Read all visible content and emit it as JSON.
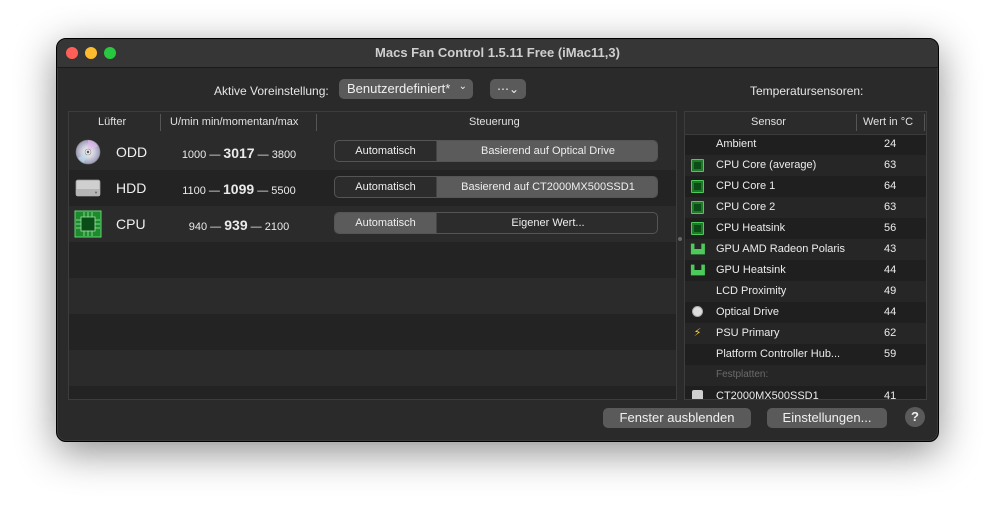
{
  "window": {
    "title": "Macs Fan Control 1.5.11 Free (iMac11,3)"
  },
  "preset": {
    "label": "Aktive Voreinstellung:",
    "value": "Benutzerdefiniert*"
  },
  "temperature_title": "Temperatursensoren:",
  "fans": {
    "columns": {
      "fan": "Lüfter",
      "rpm": "U/min min/momentan/max",
      "control": "Steuerung"
    },
    "rows": [
      {
        "name": "ODD",
        "min": "1000",
        "current": "3017",
        "max": "3800",
        "auto_label": "Automatisch",
        "control_label": "Basierend auf Optical Drive",
        "mode": "sensor",
        "icon": "optical-disc-icon"
      },
      {
        "name": "HDD",
        "min": "1100",
        "current": "1099",
        "max": "5500",
        "auto_label": "Automatisch",
        "control_label": "Basierend auf CT2000MX500SSD1",
        "mode": "sensor",
        "icon": "hard-drive-icon"
      },
      {
        "name": "CPU",
        "min": "940",
        "current": "939",
        "max": "2100",
        "auto_label": "Automatisch",
        "control_label": "Eigener Wert...",
        "mode": "auto",
        "icon": "cpu-chip-icon"
      }
    ]
  },
  "sensors": {
    "columns": {
      "sensor": "Sensor",
      "value": "Wert in °C"
    },
    "rows": [
      {
        "name": "Ambient",
        "value": "24",
        "icon": ""
      },
      {
        "name": "CPU Core (average)",
        "value": "63",
        "icon": "cpu-chip-icon"
      },
      {
        "name": "CPU Core 1",
        "value": "64",
        "icon": "cpu-chip-icon"
      },
      {
        "name": "CPU Core 2",
        "value": "63",
        "icon": "cpu-chip-icon"
      },
      {
        "name": "CPU Heatsink",
        "value": "56",
        "icon": "cpu-chip-icon"
      },
      {
        "name": "GPU AMD Radeon Polaris",
        "value": "43",
        "icon": "gpu-card-icon"
      },
      {
        "name": "GPU Heatsink",
        "value": "44",
        "icon": "gpu-card-icon"
      },
      {
        "name": "LCD Proximity",
        "value": "49",
        "icon": ""
      },
      {
        "name": "Optical Drive",
        "value": "44",
        "icon": "optical-disc-icon"
      },
      {
        "name": "PSU Primary",
        "value": "62",
        "icon": "lightning-bolt-icon"
      },
      {
        "name": "Platform Controller Hub...",
        "value": "59",
        "icon": ""
      }
    ],
    "section": "Festplatten:",
    "disk": {
      "name": "CT2000MX500SSD1",
      "value": "41",
      "icon": "drive-icon"
    }
  },
  "buttons": {
    "hide": "Fenster ausblenden",
    "settings": "Einstellungen...",
    "help": "?"
  }
}
